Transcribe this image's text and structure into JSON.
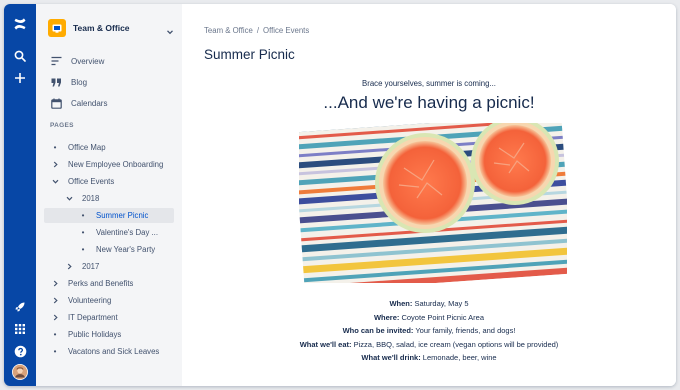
{
  "space": {
    "name": "Team & Office"
  },
  "nav": [
    {
      "label": "Overview",
      "icon": "overview-icon"
    },
    {
      "label": "Blog",
      "icon": "blog-quote-icon"
    },
    {
      "label": "Calendars",
      "icon": "calendar-icon"
    }
  ],
  "pages_label": "PAGES",
  "tree": [
    {
      "label": "Office Map",
      "mark": "bullet",
      "level": 0
    },
    {
      "label": "New Employee Onboarding",
      "mark": "chevron-right",
      "level": 0
    },
    {
      "label": "Office Events",
      "mark": "chevron-down",
      "level": 0
    },
    {
      "label": "2018",
      "mark": "chevron-down",
      "level": 1
    },
    {
      "label": "Summer Picnic",
      "mark": "bullet",
      "level": 2,
      "selected": true
    },
    {
      "label": "Valentine's Day ...",
      "mark": "bullet",
      "level": 2
    },
    {
      "label": "New Year's Party",
      "mark": "bullet",
      "level": 2
    },
    {
      "label": "2017",
      "mark": "chevron-right",
      "level": 1
    },
    {
      "label": "Perks and Benefits",
      "mark": "chevron-right",
      "level": 0
    },
    {
      "label": "Volunteering",
      "mark": "chevron-right",
      "level": 0
    },
    {
      "label": "IT Department",
      "mark": "chevron-right",
      "level": 0
    },
    {
      "label": "Public Holidays",
      "mark": "bullet",
      "level": 0
    },
    {
      "label": "Vacatons and Sick Leaves",
      "mark": "bullet",
      "level": 0
    }
  ],
  "breadcrumb": {
    "parent": "Team & Office",
    "separator": "/",
    "current": "Office Events"
  },
  "page": {
    "title": "Summer Picnic",
    "intro": "Brace yourselves, summer is coming...",
    "headline": "...And we're having a picnic!",
    "details": [
      {
        "label": "When:",
        "value": " Saturday, May 5"
      },
      {
        "label": "Where:",
        "value": " Coyote Point Picnic Area"
      },
      {
        "label": "Who can be invited:",
        "value": " Your family, friends, and dogs!"
      },
      {
        "label": "What we'll eat:",
        "value": " Pizza, BBQ, salad, ice cream (vegan options will be provided)"
      },
      {
        "label": "What we'll drink:",
        "value": " Lemonade, beer, wine"
      }
    ]
  },
  "colors": {
    "global_nav": "#0747a6",
    "sidebar": "#f4f5f7",
    "selected_row": "#e4e6ea",
    "space_logo": "#ffab00"
  }
}
